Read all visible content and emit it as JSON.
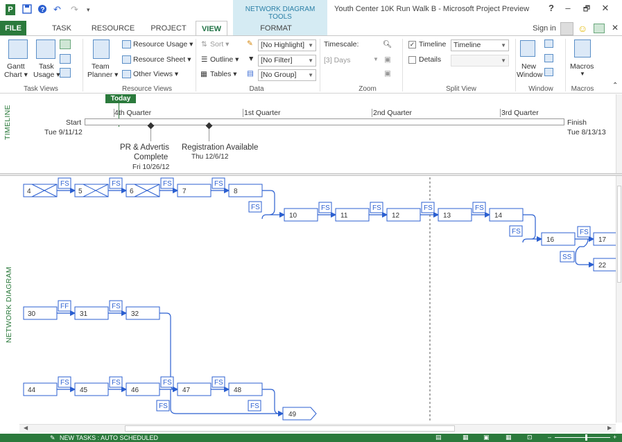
{
  "window": {
    "title": "Youth Center 10K Run Walk B - Microsoft Project Preview",
    "context_tab_group": "NETWORK DIAGRAM TOOLS",
    "help": "?",
    "minimize": "–",
    "restore": "🗗",
    "close": "✕",
    "sign_in": "Sign in"
  },
  "qat": {
    "app_icon": "P",
    "save_icon": "save-icon",
    "undo": "↶",
    "redo": "↷",
    "customize": "⋮"
  },
  "tabs": {
    "file": "FILE",
    "task": "TASK",
    "resource": "RESOURCE",
    "project": "PROJECT",
    "view": "VIEW",
    "format": "FORMAT"
  },
  "ribbon": {
    "task_views": {
      "label": "Task Views",
      "gantt": "Gantt",
      "gantt2": "Chart ▾",
      "usage": "Task",
      "usage2": "Usage ▾"
    },
    "resource_views": {
      "label": "Resource Views",
      "team": "Team",
      "team2": "Planner ▾",
      "resource_usage": "Resource Usage ▾",
      "resource_sheet": "Resource Sheet ▾",
      "other_views": "Other Views ▾"
    },
    "data": {
      "label": "Data",
      "sort": "Sort ▾",
      "outline": "Outline ▾",
      "tables": "Tables ▾",
      "highlight": "[No Highlight]",
      "filter": "[No Filter]",
      "group": "[No Group]"
    },
    "zoom": {
      "label": "Zoom",
      "timescale": "Timescale:",
      "timescale_value": "[3] Days"
    },
    "split_view": {
      "label": "Split View",
      "timeline_checked": "✓",
      "timeline": "Timeline",
      "timeline_value": "Timeline",
      "details": "Details"
    },
    "window": {
      "label": "Window",
      "new": "New",
      "new2": "Window"
    },
    "macros": {
      "label": "Macros",
      "macros": "Macros"
    }
  },
  "timeline": {
    "side_label": "TIMELINE",
    "today": "Today",
    "start_label": "Start",
    "start_date": "Tue 9/11/12",
    "finish_label": "Finish",
    "finish_date": "Tue 8/13/13",
    "quarters": [
      "4th Quarter",
      "1st Quarter",
      "2nd Quarter",
      "3rd Quarter"
    ],
    "milestones": [
      {
        "name": "PR & Advertis",
        "name2": "Complete",
        "date": "Fri 10/26/12"
      },
      {
        "name": "Registration Available",
        "date": "Thu 12/6/12"
      }
    ]
  },
  "network": {
    "side_label": "NETWORK DIAGRAM",
    "nodes": [
      {
        "id": "4",
        "done": true
      },
      {
        "id": "5",
        "done": true
      },
      {
        "id": "6",
        "done": true
      },
      {
        "id": "7"
      },
      {
        "id": "8"
      },
      {
        "id": "10"
      },
      {
        "id": "11"
      },
      {
        "id": "12"
      },
      {
        "id": "13"
      },
      {
        "id": "14"
      },
      {
        "id": "16"
      },
      {
        "id": "17"
      },
      {
        "id": "22"
      },
      {
        "id": "30"
      },
      {
        "id": "31"
      },
      {
        "id": "32"
      },
      {
        "id": "44"
      },
      {
        "id": "45"
      },
      {
        "id": "46"
      },
      {
        "id": "47"
      },
      {
        "id": "48"
      },
      {
        "id": "49"
      }
    ],
    "link_types": [
      "FS",
      "FF",
      "SS"
    ]
  },
  "status": {
    "text": "NEW TASKS : AUTO SCHEDULED"
  },
  "colors": {
    "accent": "#2b7a3c",
    "link": "#2b5fd0",
    "context_band": "#d5ebf3"
  }
}
